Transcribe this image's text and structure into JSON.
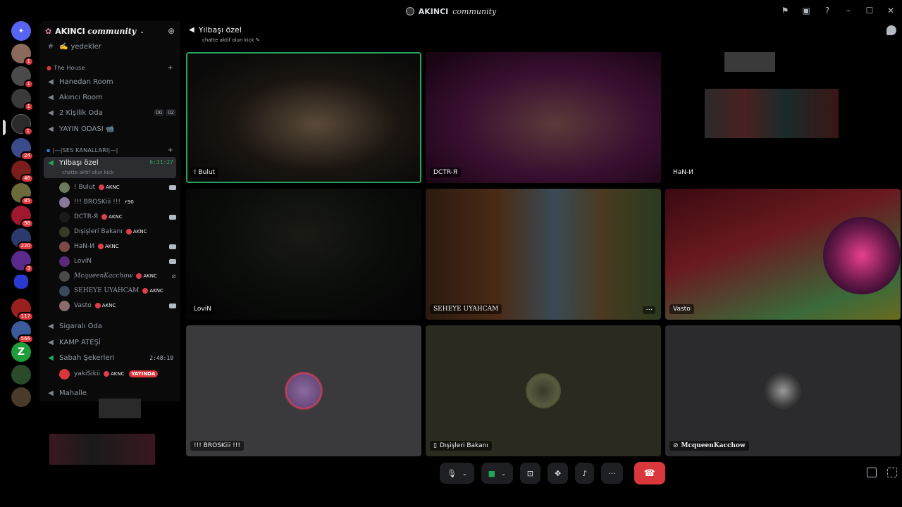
{
  "window": {
    "title_prefix": "AKINCI",
    "title_suffix": "community"
  },
  "guild": {
    "name_prefix": "AKINCI",
    "name_suffix": "community"
  },
  "sidebar": {
    "top_channel": {
      "label": "yedekler",
      "emoji": "✍️"
    },
    "category_house": "The House",
    "house_channels": [
      "Hanedan Room",
      "Akıncı Room",
      "2 Kişilik Oda",
      "YAYIN ODASI 📹"
    ],
    "two_person_counter": [
      "00",
      "02"
    ],
    "category_voice": "|—|SES KANALLARI|—|",
    "active_channel": {
      "label": "Yılbaşı özel",
      "timer": "6:31:27",
      "status": "chatte aktif olun kick"
    },
    "voice_users": [
      {
        "name": "! Bulut",
        "tag": "AKNC"
      },
      {
        "name": "!!! BROSKiii !!!",
        "tag": "⚡90"
      },
      {
        "name": "DCTR-Я",
        "tag": "AKNC"
      },
      {
        "name": "Dışişleri Bakanı",
        "tag": "AKNC"
      },
      {
        "name": "HaN-И",
        "tag": "AKNC"
      },
      {
        "name": "LoviN",
        "tag": ""
      },
      {
        "name": "McqueenKacchow",
        "tag": "AKNC"
      },
      {
        "name": "SEHEYE UYAHCAM",
        "tag": "AKNC"
      },
      {
        "name": "Vasto",
        "tag": "AKNC"
      }
    ],
    "more_channels": [
      "Sigaralı Oda",
      "KAMP ATEŞİ"
    ],
    "sabah": {
      "label": "Sabah Şekerleri",
      "timer": "2:48:19"
    },
    "sabah_user": {
      "name": "yakiSikii",
      "tag": "AKNC",
      "live": "YAYINDA"
    },
    "last_channel": "Mahalle"
  },
  "rail_badges": [
    "1",
    "1",
    "1",
    "1",
    "24",
    "46",
    "85",
    "98",
    "220",
    "3",
    "117",
    "566"
  ],
  "voice": {
    "title": "Yılbaşı özel",
    "status": "chatte aktif olun kick"
  },
  "tiles": [
    {
      "name": "! Bulut"
    },
    {
      "name": "DCTR-Я"
    },
    {
      "name": "HaN-И"
    },
    {
      "name": "LoviN"
    },
    {
      "name": "SEHEYE UYAHCAM"
    },
    {
      "name": "Vasto"
    },
    {
      "name": "!!! BROSKiii !!!"
    },
    {
      "name": "Dışişleri Bakanı"
    },
    {
      "name": "McqueenKacchow"
    }
  ],
  "colors": {
    "accent_green": "#23a55a",
    "hangup": "#da373c",
    "badge": "#da373c"
  }
}
